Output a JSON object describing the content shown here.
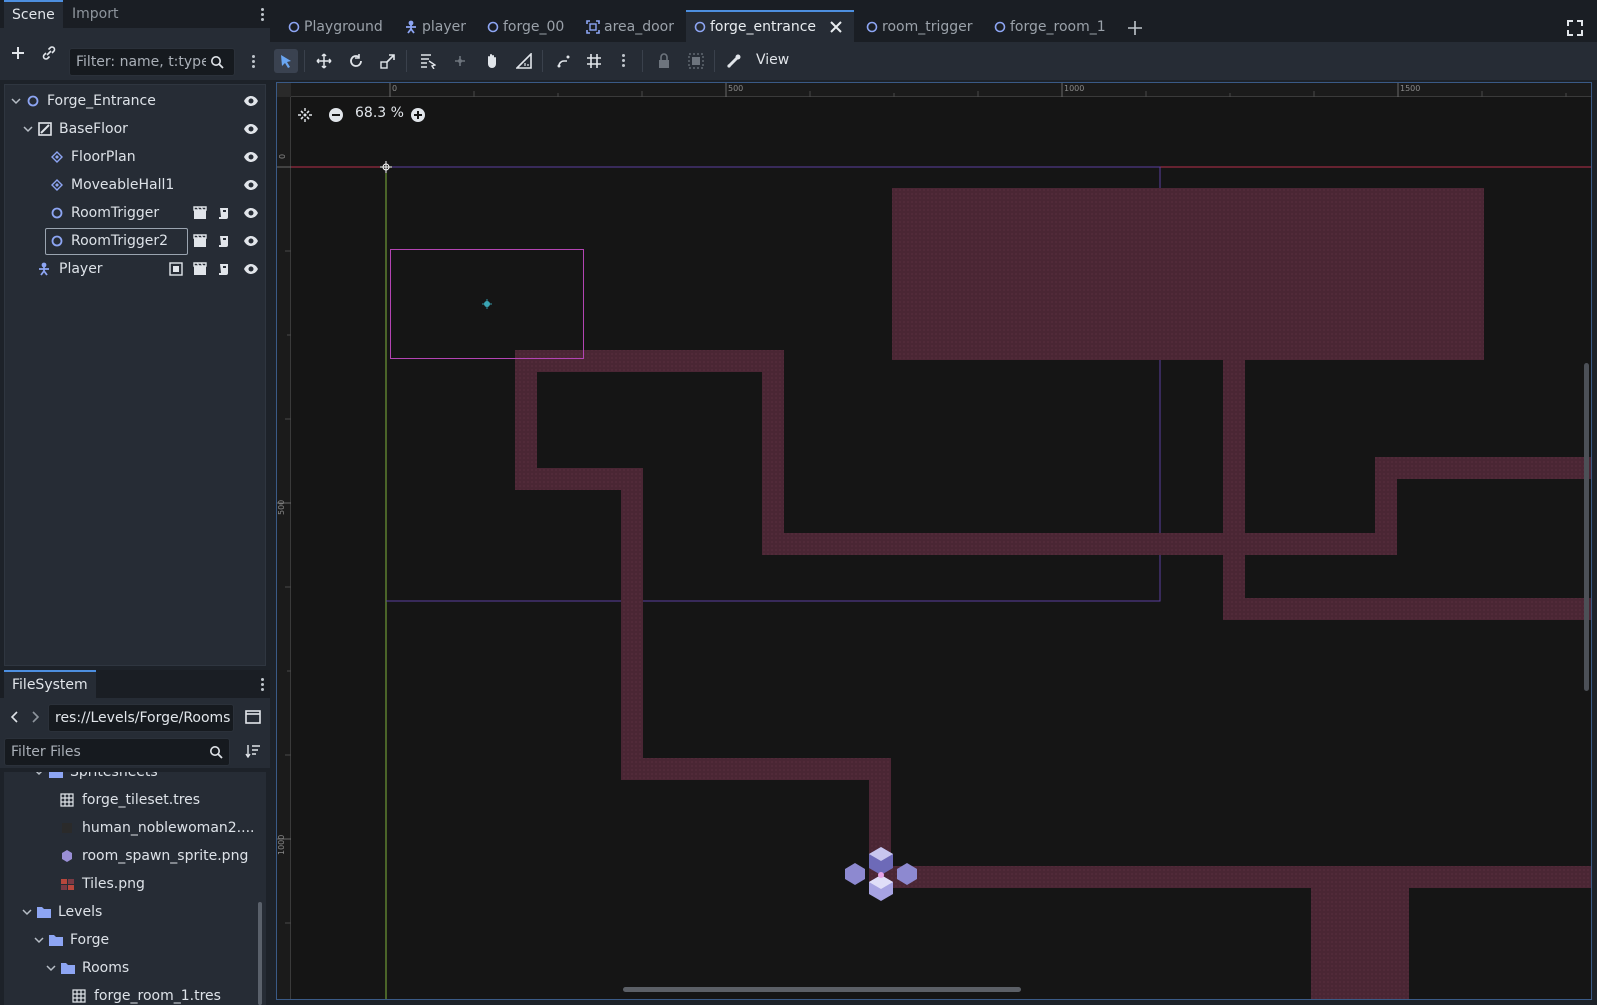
{
  "left_dock": {
    "tabs": [
      "Scene",
      "Import"
    ],
    "filter_placeholder": "Filter: name, t:type, ...",
    "tree": [
      {
        "label": "Forge_Entrance",
        "icon": "node-circle-icon"
      },
      {
        "label": "BaseFloor",
        "icon": "tilemap-icon"
      },
      {
        "label": "FloorPlan",
        "icon": "tilelayer-icon"
      },
      {
        "label": "MoveableHall1",
        "icon": "tilelayer-icon"
      },
      {
        "label": "RoomTrigger",
        "icon": "node-circle-icon"
      },
      {
        "label": "RoomTrigger2",
        "icon": "node-circle-icon"
      },
      {
        "label": "Player",
        "icon": "character-icon"
      }
    ]
  },
  "filesystem": {
    "tab": "FileSystem",
    "path": "res://Levels/Forge/Rooms",
    "filter_placeholder": "Filter Files",
    "items": [
      {
        "label": "Spritesheets",
        "type": "folder"
      },
      {
        "label": "forge_tileset.tres",
        "type": "tileset"
      },
      {
        "label": "human_noblewoman2....",
        "type": "image"
      },
      {
        "label": "room_spawn_sprite.png",
        "type": "image"
      },
      {
        "label": "Tiles.png",
        "type": "image"
      },
      {
        "label": "Levels",
        "type": "folder"
      },
      {
        "label": "Forge",
        "type": "folder"
      },
      {
        "label": "Rooms",
        "type": "folder"
      },
      {
        "label": "forge_room_1.tres",
        "type": "tileset"
      }
    ]
  },
  "scene_tabs": [
    {
      "label": "Playground"
    },
    {
      "label": "player"
    },
    {
      "label": "forge_00"
    },
    {
      "label": "area_door"
    },
    {
      "label": "forge_entrance"
    },
    {
      "label": "room_trigger"
    },
    {
      "label": "forge_room_1"
    }
  ],
  "toolbar": {
    "view_label": "View"
  },
  "viewport": {
    "zoom": "68.3 %",
    "ruler_labels": {
      "x0": "0",
      "x500": "500",
      "x1000": "1000",
      "x1500": "1500",
      "y0": "0",
      "y500": "500",
      "y1000": "1000"
    }
  },
  "colors": {
    "accent": "#4d8fe0",
    "tile": "#4a2634",
    "trigger_outline": "#b344b3"
  }
}
